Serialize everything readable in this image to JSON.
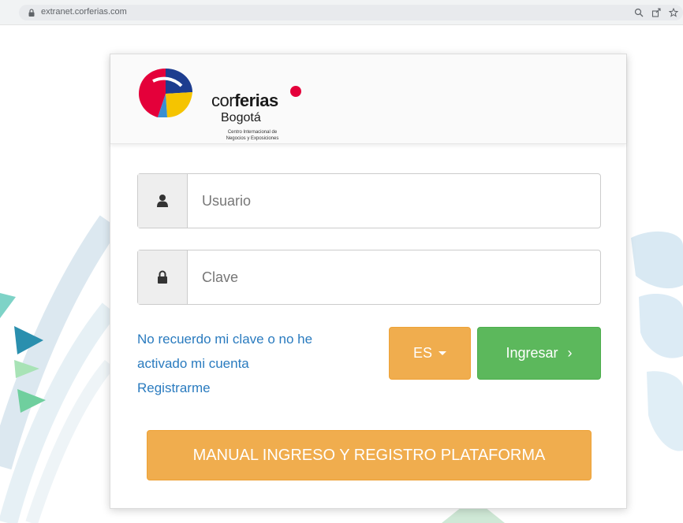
{
  "browser": {
    "url": "extranet.corferias.com"
  },
  "logo": {
    "brand_prefix": "cor",
    "brand_bold": "ferias",
    "city": "Bogotá",
    "tagline_line1": "Centro Internacional de",
    "tagline_line2": "Negocios y Exposiciones"
  },
  "form": {
    "username_placeholder": "Usuario",
    "password_placeholder": "Clave",
    "forgot_line1": "No recuerdo mi clave o no he",
    "forgot_line2": "activado mi cuenta",
    "register_label": "Registrarme",
    "language_label": "ES",
    "login_label": "Ingresar",
    "login_chevron": "›",
    "manual_label": "MANUAL INGRESO Y REGISTRO PLATAFORMA"
  },
  "colors": {
    "orange_button": "#f0ad4e",
    "green_button": "#5cb85c",
    "link_blue": "#2a7bbf",
    "brand_red": "#e4003a"
  },
  "icons": {
    "username": "user-icon",
    "password": "lock-icon",
    "address_lock": "lock-icon",
    "search": "search-icon",
    "share": "share-icon",
    "bookmark": "star-icon"
  }
}
